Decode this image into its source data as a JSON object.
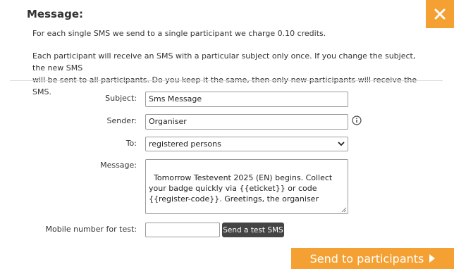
{
  "dialog": {
    "title": "Message:",
    "info_cost": "For each single SMS we send to a single participant we charge 0.10 credits.",
    "info_subject_line1": "Each participant will receive an SMS with a particular subject only once. If you change the subject, the new SMS",
    "info_subject_line2": "will be sent to all participants. Do you keep it the same, then only new participants will receive the SMS."
  },
  "form": {
    "subject_label": "Subject:",
    "subject_value": "Sms Message",
    "sender_label": "Sender:",
    "sender_value": "Organiser",
    "to_label": "To:",
    "to_value": "registered persons",
    "message_label": "Message:",
    "message_value": "Tomorrow Testevent 2025 (EN) begins. Collect your badge quickly via {{eticket}} or code {{register-code}}. Greetings, the organiser",
    "mobile_label": "Mobile number for test:",
    "mobile_value": ""
  },
  "buttons": {
    "test_sms": "Send a test SMS",
    "send": "Send to participants"
  },
  "colors": {
    "accent": "#f5a033",
    "dark_button": "#444444"
  },
  "icons": {
    "close": "close-icon",
    "info": "info-icon",
    "dropdown": "chevron-down-icon",
    "send_arrow": "triangle-right-icon"
  }
}
